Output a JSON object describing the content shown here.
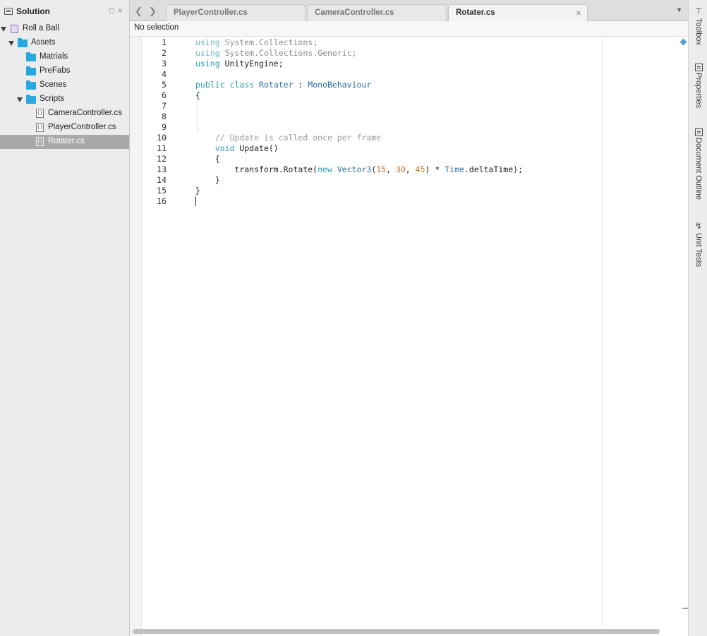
{
  "sidebar": {
    "title": "Solution",
    "tree": [
      {
        "label": "Roll a Ball",
        "icon": "project-icon"
      },
      {
        "label": "Assets",
        "icon": "folder-icon"
      },
      {
        "label": "Matrials",
        "icon": "folder-icon"
      },
      {
        "label": "PreFabs",
        "icon": "folder-icon"
      },
      {
        "label": "Scenes",
        "icon": "folder-icon"
      },
      {
        "label": "Scripts",
        "icon": "folder-icon"
      },
      {
        "label": "CameraController.cs",
        "icon": "file-icon"
      },
      {
        "label": "PlayerController.cs",
        "icon": "file-icon"
      },
      {
        "label": "Rotater.cs",
        "icon": "file-icon",
        "selected": true
      }
    ]
  },
  "tabs": [
    {
      "label": "PlayerController.cs"
    },
    {
      "label": "CameraController.cs"
    },
    {
      "label": "Rotater.cs",
      "active": true
    }
  ],
  "breadcrumb": "No selection",
  "editor": {
    "line_numbers": [
      "1",
      "2",
      "3",
      "4",
      "5",
      "6",
      "7",
      "8",
      "9",
      "10",
      "11",
      "12",
      "13",
      "14",
      "15",
      "16"
    ],
    "lines": [
      "using System.Collections;",
      "using System.Collections.Generic;",
      "using UnityEngine;",
      "",
      "public class Rotater : MonoBehaviour",
      "{",
      "",
      "",
      "",
      "    // Update is called once per frame",
      "    void Update()",
      "    {",
      "        transform.Rotate(new Vector3(15, 30, 45) * Time.deltaTime);",
      "    }",
      "}",
      ""
    ]
  },
  "dock": [
    {
      "label": "Toolbox",
      "icon": "toolbox-icon"
    },
    {
      "label": "Properties",
      "icon": "properties-icon"
    },
    {
      "label": "Document Outline",
      "icon": "document-outline-icon"
    },
    {
      "label": "Unit Tests",
      "icon": "unit-tests-icon"
    }
  ],
  "colors": {
    "folder": "#29a8e0",
    "selection": "#a9a9a9",
    "keyword": "#2a9eb5",
    "type": "#2e6da5",
    "number": "#d46d16",
    "comment": "#9a9a9a"
  }
}
